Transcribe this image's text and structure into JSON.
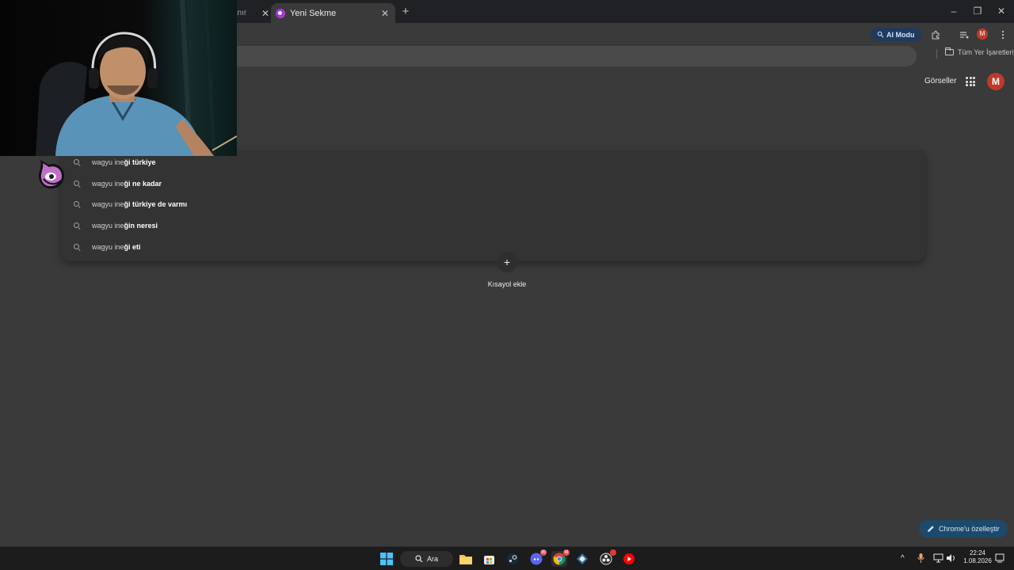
{
  "browser": {
    "tabs": [
      {
        "title": "anır -",
        "active": false
      },
      {
        "title": "Yeni Sekme",
        "active": true
      }
    ],
    "close_tab_glyph": "✕",
    "new_tab_glyph": "+",
    "window_controls": {
      "minimize": "–",
      "maximize": "❐",
      "close": "✕"
    }
  },
  "toolbar": {
    "ai_mode_label": "AI Modu",
    "icons": [
      "extensions-icon",
      "media-control-icon",
      "profile-avatar",
      "more-menu-icon"
    ],
    "profile_initial": "M"
  },
  "bookmarks": {
    "all_bookmarks_label": "Tüm Yer İşaretleri"
  },
  "ntp": {
    "images_link": "Görseller",
    "profile_initial": "M",
    "shortcut_plus": "+",
    "shortcut_label": "Kısayol ekle",
    "customize_label": "Chrome'u özelleştir"
  },
  "suggestions": [
    {
      "prefix": "wagyu ine",
      "rest": "ği türkiye"
    },
    {
      "prefix": "wagyu ine",
      "rest": "ği ne kadar"
    },
    {
      "prefix": "wagyu ine",
      "rest": "ği türkiye de varmı"
    },
    {
      "prefix": "wagyu ine",
      "rest": "ğin neresi"
    },
    {
      "prefix": "wagyu ine",
      "rest": "ği eti"
    }
  ],
  "taskbar": {
    "search_label": "Ara",
    "apps": [
      "start-icon",
      "search",
      "file-explorer-icon",
      "store-icon",
      "steam-icon",
      "discord-icon",
      "chrome-icon",
      "app-icon",
      "obs-icon",
      "youtube-music-icon"
    ],
    "discord_badge": "99",
    "chrome_badge": "M",
    "tray_chevron": "^",
    "time": "22:24",
    "date": "1.08.2026"
  },
  "colors": {
    "page_bg": "#3a3a3a",
    "tabstrip_bg": "#202124",
    "accent_blue": "#1d4a6b",
    "avatar_red": "#c0392b"
  }
}
